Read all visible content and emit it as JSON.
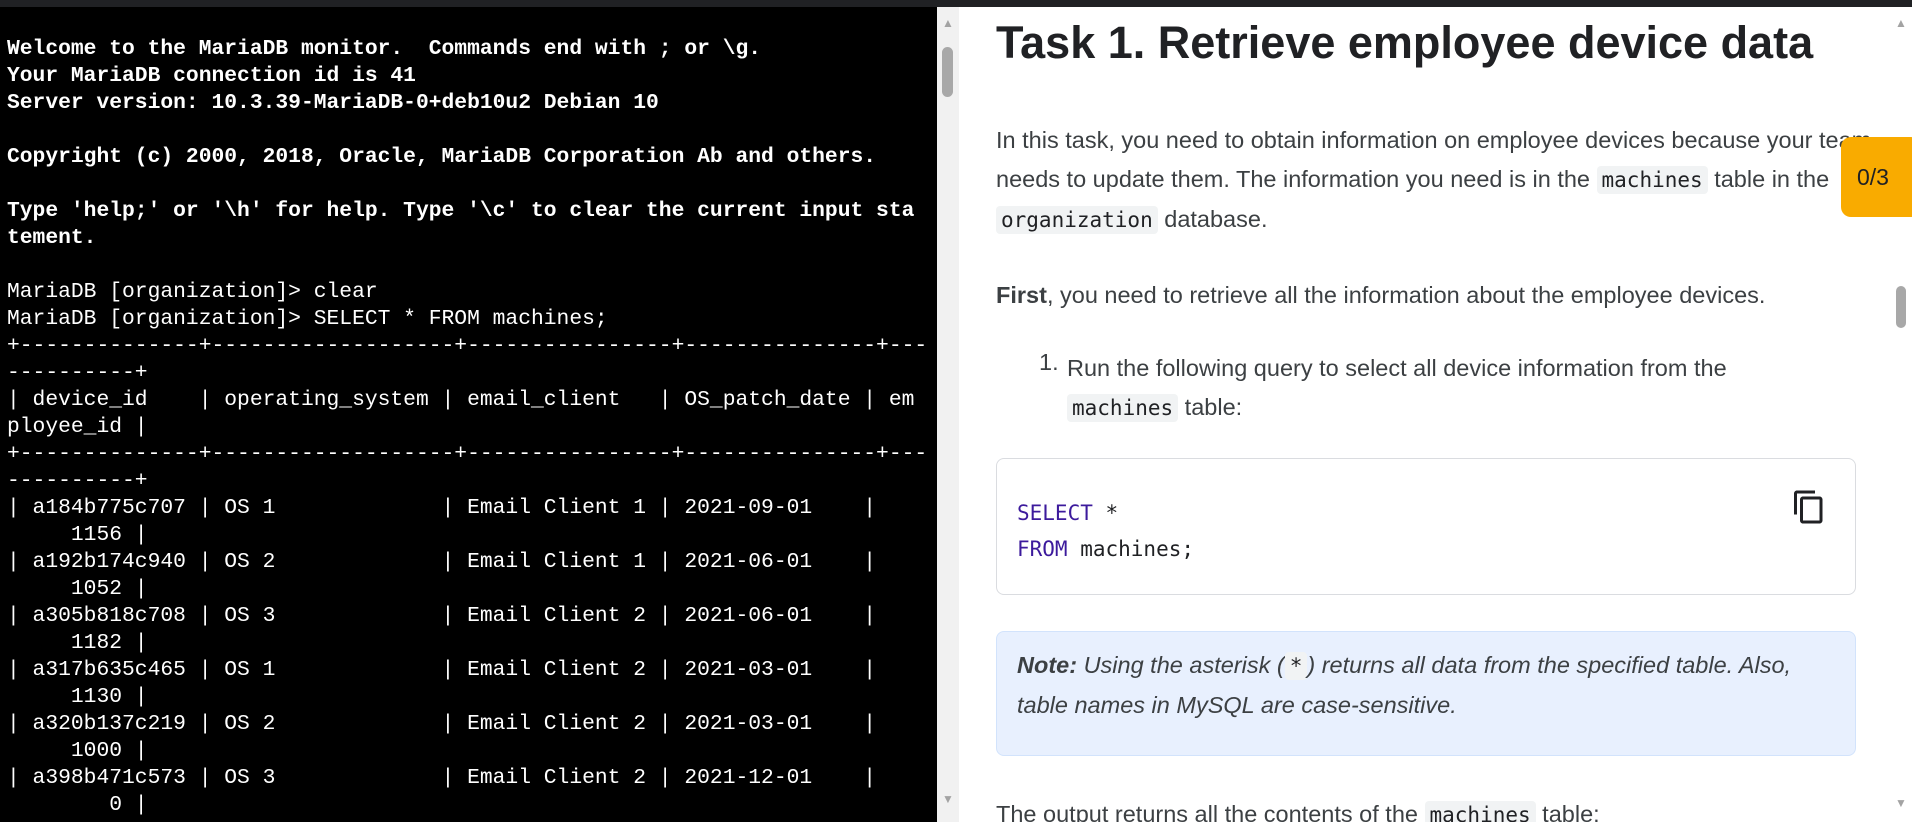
{
  "terminal": {
    "lines": [
      {
        "text": "Welcome to the MariaDB monitor.  Commands end with ; or \\g.",
        "bold": true
      },
      {
        "text": "Your MariaDB connection id is 41",
        "bold": true
      },
      {
        "text": "Server version: 10.3.39-MariaDB-0+deb10u2 Debian 10",
        "bold": true
      },
      {
        "text": "",
        "bold": true
      },
      {
        "text": "Copyright (c) 2000, 2018, Oracle, MariaDB Corporation Ab and others.",
        "bold": true
      },
      {
        "text": "",
        "bold": true
      },
      {
        "text": "Type 'help;' or '\\h' for help. Type '\\c' to clear the current input sta",
        "bold": true
      },
      {
        "text": "tement.",
        "bold": true
      },
      {
        "text": "",
        "bold": false
      },
      {
        "text": "MariaDB [organization]> clear",
        "bold": false
      },
      {
        "text": "MariaDB [organization]> SELECT * FROM machines;",
        "bold": false
      },
      {
        "text": "+--------------+-------------------+----------------+---------------+---",
        "bold": false
      },
      {
        "text": "----------+",
        "bold": false
      },
      {
        "text": "| device_id    | operating_system | email_client   | OS_patch_date | em",
        "bold": false
      },
      {
        "text": "ployee_id |",
        "bold": false
      },
      {
        "text": "+--------------+-------------------+----------------+---------------+---",
        "bold": false
      },
      {
        "text": "----------+",
        "bold": false
      },
      {
        "text": "| a184b775c707 | OS 1             | Email Client 1 | 2021-09-01    |",
        "bold": false
      },
      {
        "text": "     1156 |",
        "bold": false
      },
      {
        "text": "| a192b174c940 | OS 2             | Email Client 1 | 2021-06-01    |",
        "bold": false
      },
      {
        "text": "     1052 |",
        "bold": false
      },
      {
        "text": "| a305b818c708 | OS 3             | Email Client 2 | 2021-06-01    |",
        "bold": false
      },
      {
        "text": "     1182 |",
        "bold": false
      },
      {
        "text": "| a317b635c465 | OS 1             | Email Client 2 | 2021-03-01    |",
        "bold": false
      },
      {
        "text": "     1130 |",
        "bold": false
      },
      {
        "text": "| a320b137c219 | OS 2             | Email Client 2 | 2021-03-01    |",
        "bold": false
      },
      {
        "text": "     1000 |",
        "bold": false
      },
      {
        "text": "| a398b471c573 | OS 3             | Email Client 2 | 2021-12-01    |",
        "bold": false
      },
      {
        "text": "        0 |",
        "bold": false
      }
    ]
  },
  "lab": {
    "title": "Task 1. Retrieve employee device data",
    "intro": {
      "part1": "In this task, you need to obtain information on employee devices because your team needs to update them. The information you need is in the ",
      "code1": "machines",
      "part2": " table in the ",
      "code2": "organization",
      "part3": " database."
    },
    "first": {
      "bold": "First",
      "rest": ", you need to retrieve all the information about the employee devices."
    },
    "step1": {
      "number": "1.",
      "part1": "Run the following query to select all device information from the ",
      "code": "machines",
      "part2": " table:"
    },
    "code_block": {
      "line1_kw": "SELECT",
      "line1_rest": " *",
      "line2_kw": "FROM",
      "line2_rest": " machines;"
    },
    "note": {
      "label": "Note:",
      "part1": " Using the asterisk (",
      "code": "*",
      "part2": ") returns all data from the specified table. Also, table names in MySQL are case-sensitive."
    },
    "output": {
      "part1": "The output returns all the contents of the ",
      "code": "machines",
      "part2": " table:"
    },
    "progress": "0/3"
  },
  "icons": {
    "copy": "copy-icon",
    "scroll_up": "arrow-up-icon",
    "scroll_down": "arrow-down-icon"
  },
  "colors": {
    "terminal_bg": "#000000",
    "note_bg": "#e8f0fe",
    "progress_bg": "#f9ab00",
    "keyword": "#3c1a9c"
  }
}
